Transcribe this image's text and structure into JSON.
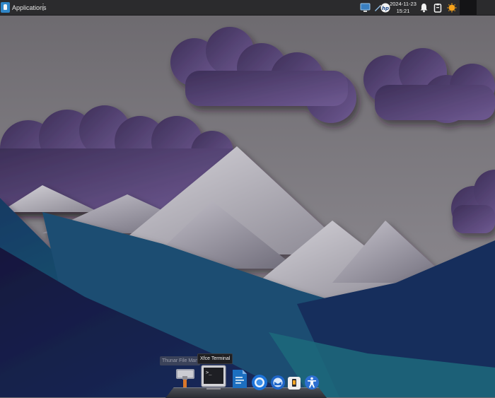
{
  "panel": {
    "menu_label": "Applications",
    "clock_date": "2024-11-23",
    "clock_time": "15:21",
    "tray_icons": [
      "display-icon",
      "pen-icon",
      "hp-icon",
      "bell-icon",
      "clipboard-icon",
      "weather-icon"
    ]
  },
  "dock": {
    "items": [
      {
        "name": "file-manager-icon",
        "tooltip": "Thunar File Man"
      },
      {
        "name": "terminal-icon",
        "tooltip": "Xfce Terminal"
      },
      {
        "name": "document-viewer-icon"
      },
      {
        "name": "web-browser-icon"
      },
      {
        "name": "mail-client-icon"
      },
      {
        "name": "mobile-device-icon"
      },
      {
        "name": "accessibility-icon"
      }
    ]
  },
  "colors": {
    "panel_bg": "#2b2b2d",
    "sky": "#7a777c",
    "clouds": "#5a4a7a",
    "hills_teal": "#1e5f78",
    "hills_navy": "#14204a"
  }
}
